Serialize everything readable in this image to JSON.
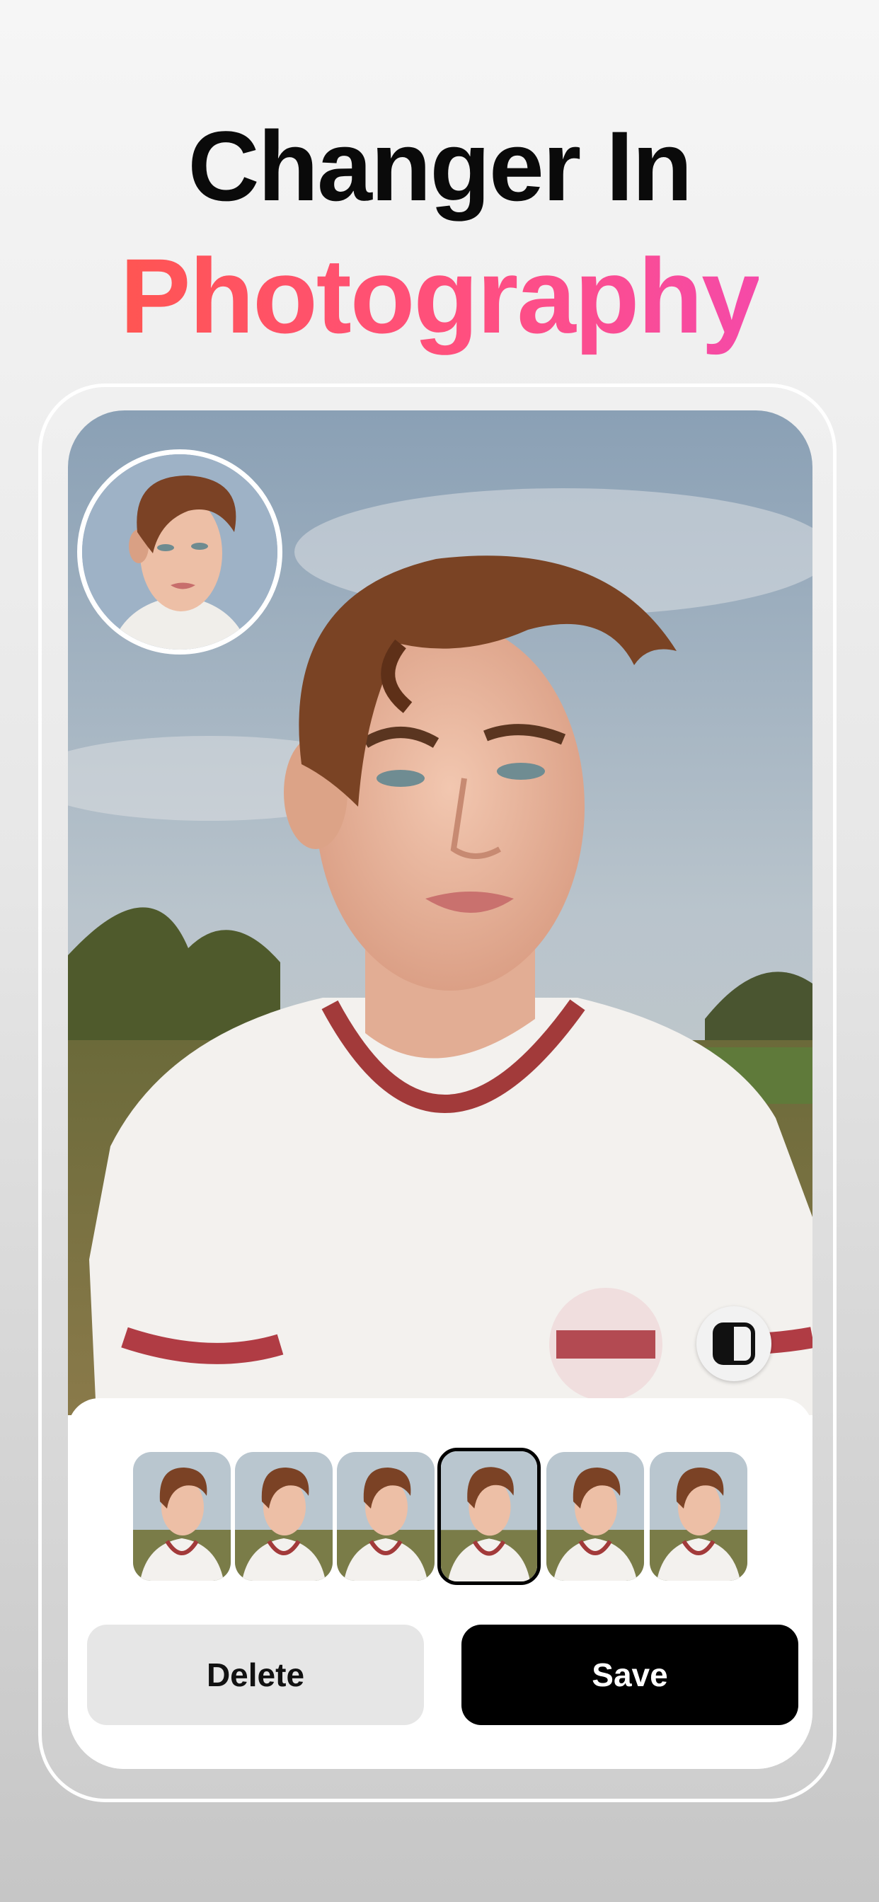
{
  "headline": {
    "line1": "Changer In",
    "line2": "Photography"
  },
  "colors": {
    "accent_start": "#ff5552",
    "accent_end": "#f54aa8",
    "save_bg": "#000000",
    "delete_bg": "#e6e6e6"
  },
  "editor": {
    "preview_image": "portrait-photo",
    "original_thumbnail": "original-face-thumbnail",
    "compare_icon": "split-compare-icon",
    "variants": [
      {
        "label": "variant-1",
        "selected": false
      },
      {
        "label": "variant-2",
        "selected": false
      },
      {
        "label": "variant-3",
        "selected": false
      },
      {
        "label": "variant-4",
        "selected": true
      },
      {
        "label": "variant-5",
        "selected": false
      },
      {
        "label": "variant-6",
        "selected": false
      }
    ],
    "delete_label": "Delete",
    "save_label": "Save"
  }
}
